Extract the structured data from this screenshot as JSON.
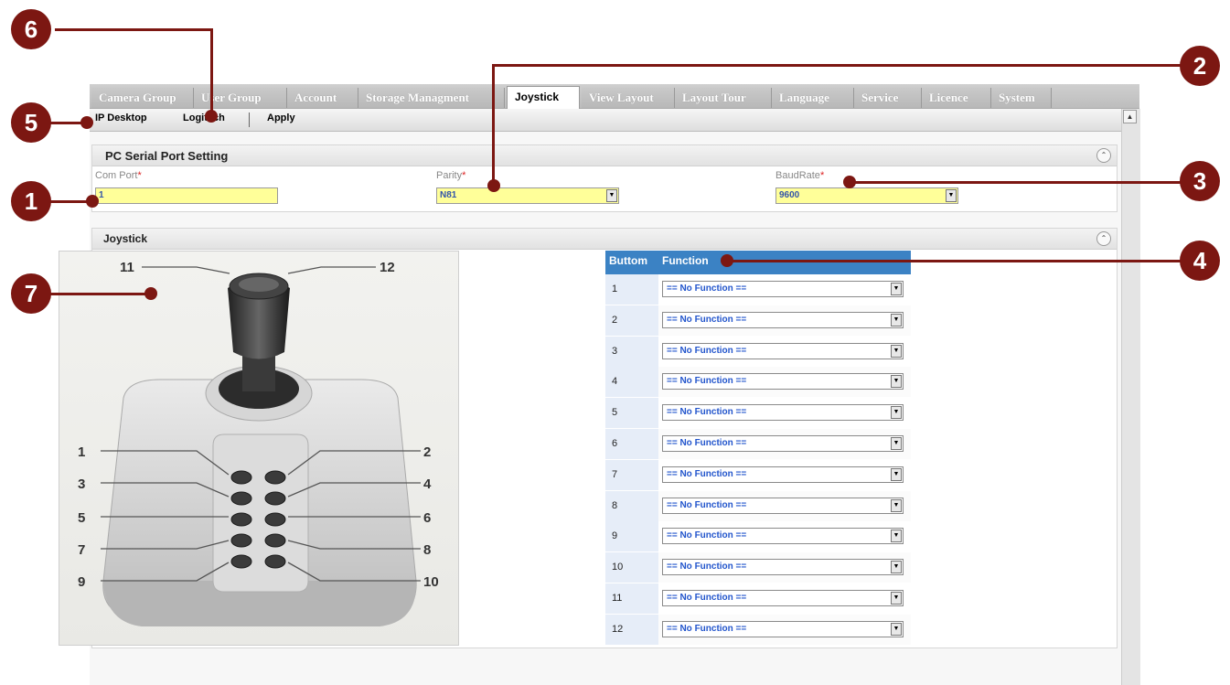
{
  "tabs": [
    {
      "label": "Camera Group"
    },
    {
      "label": "User Group"
    },
    {
      "label": "Account"
    },
    {
      "label": "Storage Managment"
    },
    {
      "label": "Joystick"
    },
    {
      "label": "View Layout"
    },
    {
      "label": "Layout Tour"
    },
    {
      "label": "Language"
    },
    {
      "label": "Service"
    },
    {
      "label": "Licence"
    },
    {
      "label": "System"
    }
  ],
  "active_tab": "Joystick",
  "toolbar": {
    "item1": "IP Desktop",
    "item2": "Logitech",
    "apply": "Apply"
  },
  "serial_panel": {
    "title": "PC Serial Port Setting",
    "com_port_label": "Com Port",
    "com_port_value": "1",
    "parity_label": "Parity",
    "parity_value": "N81",
    "baud_label": "BaudRate",
    "baud_value": "9600",
    "required_mark": "*"
  },
  "joystick_panel": {
    "title": "Joystick",
    "col_button": "Buttom",
    "col_function": "Function",
    "rows": [
      {
        "n": "1",
        "f": "== No Function =="
      },
      {
        "n": "2",
        "f": "== No Function =="
      },
      {
        "n": "3",
        "f": "== No Function =="
      },
      {
        "n": "4",
        "f": "== No Function =="
      },
      {
        "n": "5",
        "f": "== No Function =="
      },
      {
        "n": "6",
        "f": "== No Function =="
      },
      {
        "n": "7",
        "f": "== No Function =="
      },
      {
        "n": "8",
        "f": "== No Function =="
      },
      {
        "n": "9",
        "f": "== No Function =="
      },
      {
        "n": "10",
        "f": "== No Function =="
      },
      {
        "n": "11",
        "f": "== No Function =="
      },
      {
        "n": "12",
        "f": "== No Function =="
      }
    ]
  },
  "joystick_labels": [
    "1",
    "2",
    "3",
    "4",
    "5",
    "6",
    "7",
    "8",
    "9",
    "10",
    "11",
    "12"
  ],
  "callouts": [
    "1",
    "2",
    "3",
    "4",
    "5",
    "6",
    "7"
  ],
  "colors": {
    "callout": "#7c1712",
    "grid_header": "#3b82c4",
    "input_bg": "#ffff99"
  }
}
